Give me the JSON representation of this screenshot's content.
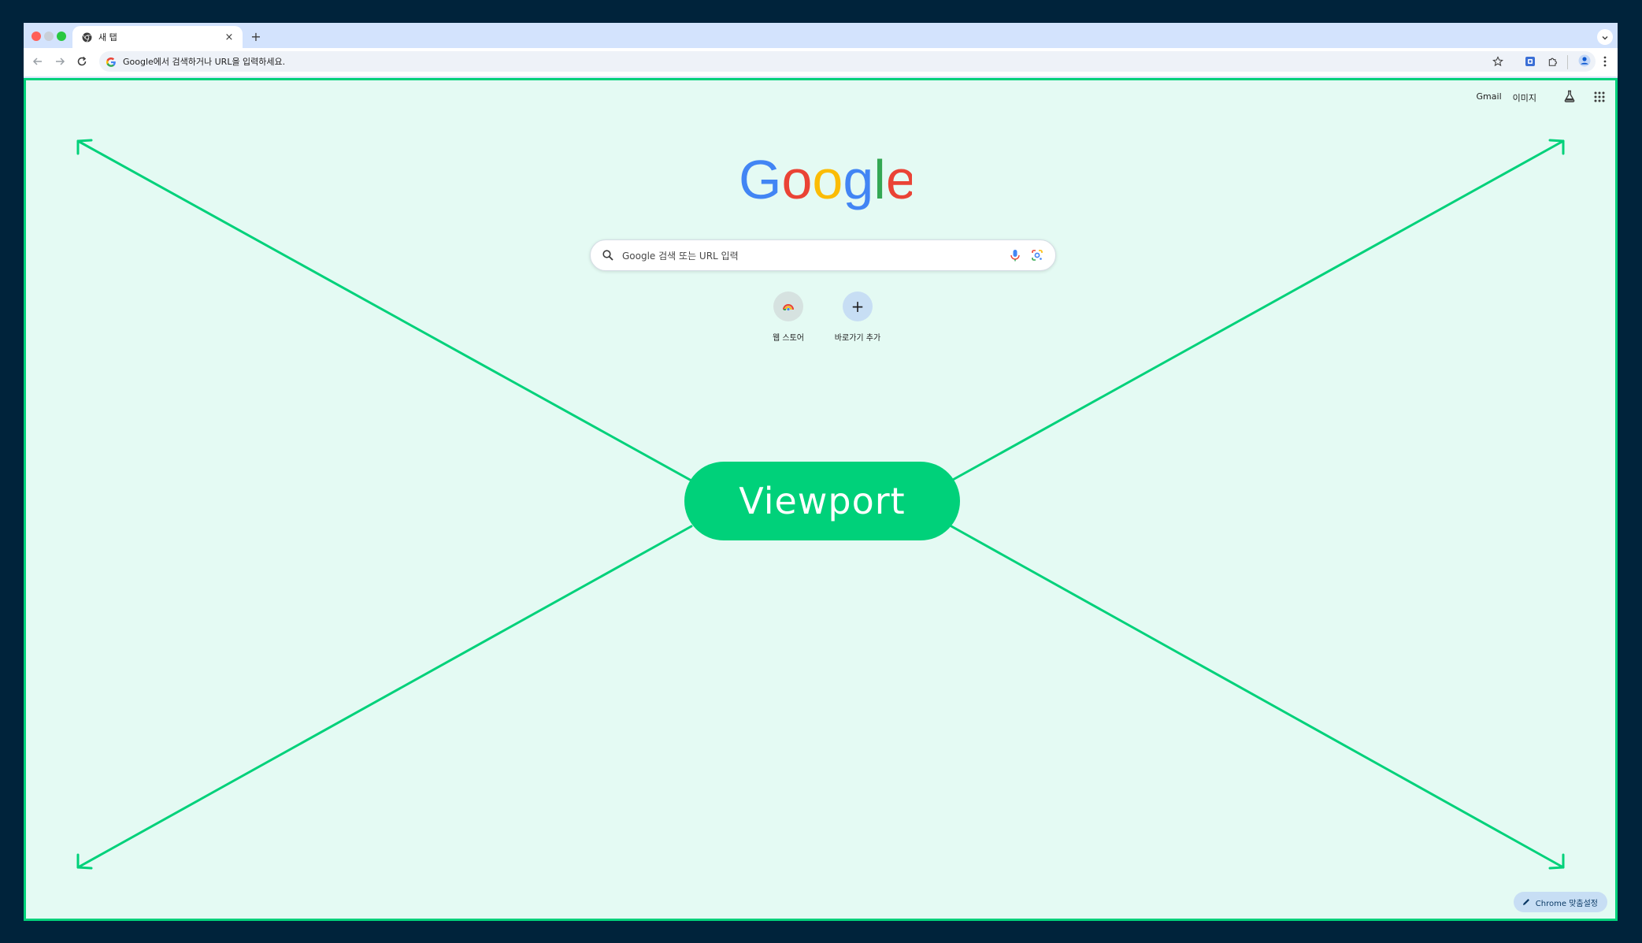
{
  "tab": {
    "title": "새 탭",
    "close_glyph": "×"
  },
  "new_tab_glyph": "+",
  "omnibox": {
    "text": "Google에서 검색하거나 URL을 입력하세요."
  },
  "header_links": {
    "gmail": "Gmail",
    "images": "이미지"
  },
  "search": {
    "placeholder": "Google 검색 또는 URL 입력"
  },
  "shortcuts": [
    {
      "label": "웹 스토어"
    },
    {
      "label": "바로가기 추가",
      "glyph": "+"
    }
  ],
  "overlay": {
    "label": "Viewport"
  },
  "customize": {
    "label": "Chrome 맞춤설정"
  },
  "colors": {
    "accent": "#00d17a",
    "viewport_bg": "#e4faf3",
    "frame_bg": "#00233b",
    "google_blue": "#4285f4",
    "google_red": "#ea4335",
    "google_yellow": "#fbbc05",
    "google_green": "#34a853"
  },
  "icons": [
    "chrome-icon",
    "close-icon",
    "plus-icon",
    "chevron-down-icon",
    "back-arrow-icon",
    "forward-arrow-icon",
    "reload-icon",
    "google-g-icon",
    "star-icon",
    "extension-icon",
    "puzzle-icon",
    "profile-icon",
    "kebab-menu-icon",
    "labs-flask-icon",
    "apps-grid-icon",
    "search-icon",
    "mic-icon",
    "lens-icon",
    "pencil-icon"
  ]
}
